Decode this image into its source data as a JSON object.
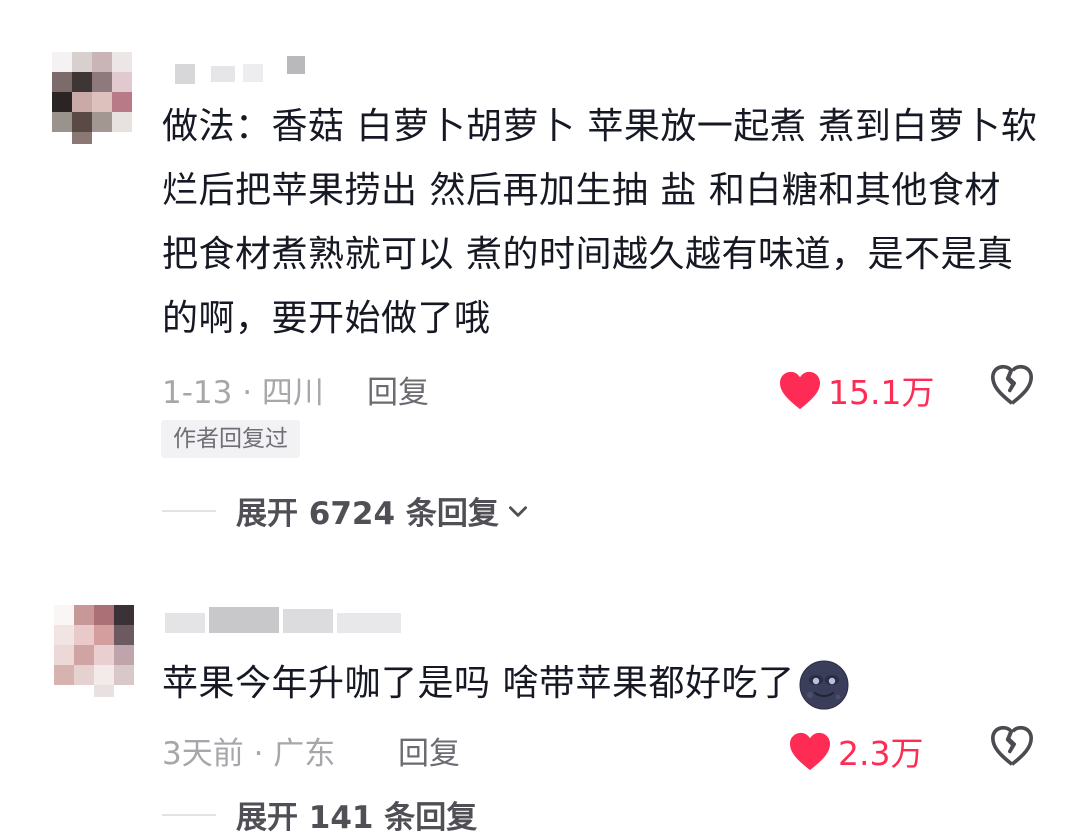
{
  "comments": [
    {
      "text": "做法：香菇 白萝卜胡萝卜  苹果放一起煮   煮到白萝卜软烂后把苹果捞出  然后再加生抽  盐 和白糖和其他食材   把食材煮熟就可以 煮的时间越久越有味道，是不是真的啊，要开始做了哦",
      "date_location": "1-13 · 四川",
      "reply_label": "回复",
      "likes": "15.1万",
      "badge": "作者回复过",
      "expand_label": "展开 6724 条回复",
      "avatar_icon": "user-avatar-mosaic",
      "like_color": "#fe2c55"
    },
    {
      "text": "苹果今年升咖了是吗 啥带苹果都好吃了",
      "date_location": "3天前 · 广东",
      "reply_label": "回复",
      "likes": "2.3万",
      "expand_label": "展开 141 条回复",
      "emoji_icon": "dark-moon-face-emoji",
      "avatar_icon": "user-avatar-mosaic"
    }
  ]
}
